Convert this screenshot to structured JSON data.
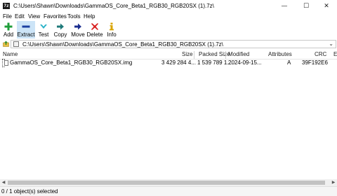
{
  "window": {
    "title": "C:\\Users\\Shawn\\Downloads\\GammaOS_Core_Beta1_RGB30_RGB20SX (1).7z\\",
    "app_icon_text": "7z",
    "minimize": "—",
    "maximize": "☐",
    "close": "✕"
  },
  "menu": [
    "File",
    "Edit",
    "View",
    "Favorites",
    "Tools",
    "Help"
  ],
  "toolbar": {
    "add": "Add",
    "extract": "Extract",
    "test": "Test",
    "copy": "Copy",
    "move": "Move",
    "delete": "Delete",
    "info": "Info",
    "colors": {
      "add": "#1f9e3a",
      "extract": "#1c3fa0",
      "test": "#2bb3c8",
      "copy": "#1f7a7a",
      "move": "#1c2f90",
      "delete": "#d81e1e",
      "info": "#d9a400"
    }
  },
  "address": {
    "path": "C:\\Users\\Shawn\\Downloads\\GammaOS_Core_Beta1_RGB30_RGB20SX (1).7z\\",
    "dropdown": "⌄"
  },
  "columns": {
    "name": "Name",
    "size": "Size",
    "packed": "Packed Size",
    "modified": "Modified",
    "attributes": "Attributes",
    "crc": "CRC",
    "extra": "E"
  },
  "rows": [
    {
      "name": "GammaOS_Core_Beta1_RGB30_RGB20SX.img",
      "size": "3 429 284 4...",
      "packed": "1 539 789 1...",
      "modified": "2024-09-15...",
      "attributes": "A",
      "crc": "39F192E6"
    }
  ],
  "scrollbar": {
    "left": "◀",
    "right": "▶"
  },
  "status": "0 / 1 object(s) selected"
}
